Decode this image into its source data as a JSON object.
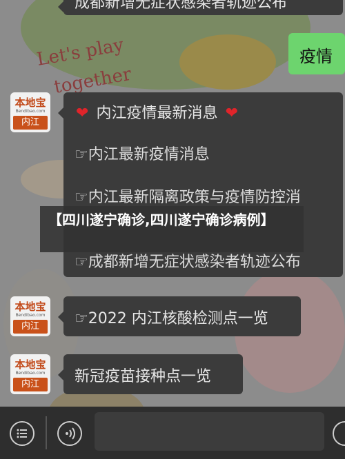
{
  "top_partial": "成都新增无症状感染者轨迹公布",
  "user_bubble": {
    "text": "疫情",
    "bg": "#6dd46e"
  },
  "avatar": {
    "brand": "本地宝",
    "domain": "Bendibao.com",
    "city": "内江"
  },
  "menu": {
    "title": "内江疫情最新消息",
    "items": [
      "☞内江最新疫情消息",
      "☞内江最新隔离政策与疫情防控消",
      "☞成都新增无症状感染者轨迹公布"
    ]
  },
  "msg_testing": "☞2022 内江核酸检测点一览",
  "msg_vaccine": "新冠疫苗接种点一览",
  "overlay_text": "【四川遂宁确诊,四川遂宁确诊病例】",
  "colors": {
    "accent_green": "#6dd46e",
    "heart_red": "#e0242a",
    "bubble": "#3b3b3b"
  }
}
